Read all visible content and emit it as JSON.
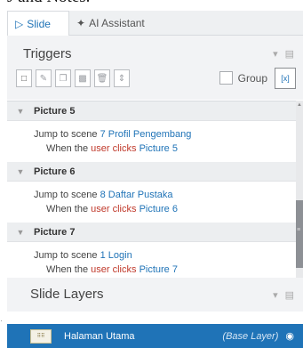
{
  "caption": "J and Notes.",
  "tabs": [
    {
      "label": "Slide",
      "icon": "slide-icon"
    },
    {
      "label": "AI Assistant",
      "icon": "sparkle-icon"
    }
  ],
  "triggers": {
    "title": "Triggers",
    "group_label": "Group",
    "toolbar_icons": [
      "new-trigger-icon",
      "edit-trigger-icon",
      "copy-icon",
      "paste-icon",
      "delete-icon",
      "move-up-down-icon"
    ],
    "items": [
      {
        "heading": "Picture 5",
        "action": "Jump to scene",
        "target": "7 Profil Pengembang",
        "cond_prefix": "When the",
        "cond_user": "user clicks",
        "cond_obj": "Picture 5"
      },
      {
        "heading": "Picture 6",
        "action": "Jump to scene",
        "target": "8 Daftar Pustaka",
        "cond_prefix": "When the",
        "cond_user": "user clicks",
        "cond_obj": "Picture 6"
      },
      {
        "heading": "Picture 7",
        "action": "Jump to scene",
        "target": "1 Login",
        "cond_prefix": "When the",
        "cond_user": "user clicks",
        "cond_obj": "Picture 7"
      }
    ]
  },
  "layers": {
    "title": "Slide Layers",
    "rows": [
      {
        "name": "Halaman Utama",
        "tag": "(Base Layer)",
        "thumb_text": "⠿⠿"
      }
    ]
  },
  "colors": {
    "accent": "#1f73b7",
    "user_red": "#c0392b"
  }
}
